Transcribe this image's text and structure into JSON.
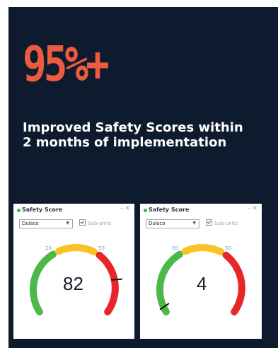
{
  "headline": "95%+",
  "subtext_line1": "Improved Safety Scores within",
  "subtext_line2": "2 months of implementation",
  "colors": {
    "background": "#0e1a2e",
    "headline": "#ee5a40",
    "gauge_green": "#4cb84a",
    "gauge_yellow": "#f7c325",
    "gauge_red": "#e8262a",
    "status_dot": "#3fb34a"
  },
  "widgets": [
    {
      "title": "Safety Score",
      "minimize_icon": "minimize-icon",
      "close_icon": "close-icon",
      "dropdown_value": "Dulsco",
      "checkbox_label": "Sub-units",
      "checkbox_checked": true,
      "tick_20": "20",
      "tick_50": "50",
      "score": "82",
      "score_value": 82
    },
    {
      "title": "Safety Score",
      "minimize_icon": "minimize-icon",
      "close_icon": "close-icon",
      "dropdown_value": "Dulsco",
      "checkbox_label": "Sub-units",
      "checkbox_checked": true,
      "tick_20": "20",
      "tick_50": "50",
      "score": "4",
      "score_value": 4
    }
  ]
}
